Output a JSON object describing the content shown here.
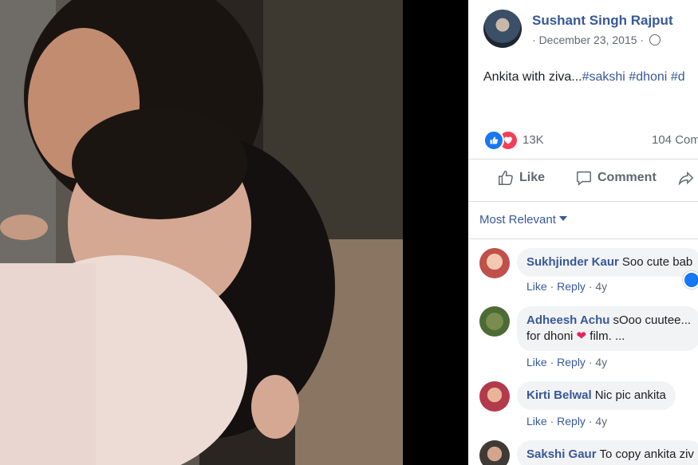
{
  "post": {
    "author": "Sushant Singh Rajput",
    "date": "December 23, 2015",
    "date_sep": "·",
    "caption_text": "Ankita with ziva...",
    "hashtags": [
      "#sakshi",
      "#dhoni",
      "#d"
    ]
  },
  "reactions": {
    "count": "13K",
    "comments": "104 Com"
  },
  "actions": {
    "like": "Like",
    "comment": "Comment"
  },
  "sort": {
    "label": "Most Relevant"
  },
  "comments": [
    {
      "name": "Sukhjinder Kaur",
      "text": "Soo cute bab",
      "like": "Like",
      "reply": "Reply",
      "time": "4y"
    },
    {
      "name": "Adheesh Achu",
      "text": "sOoo cuutee...",
      "text2": "for dhoni",
      "text2b": "film. ...",
      "like": "Like",
      "reply": "Reply",
      "time": "4y"
    },
    {
      "name": "Kirti Belwal",
      "text": "Nic pic ankita",
      "like": "Like",
      "reply": "Reply",
      "time": "4y"
    },
    {
      "name": "Sakshi Gaur",
      "text": "To copy ankita ziv"
    }
  ],
  "colors": {
    "link_blue": "#385898",
    "like_blue": "#1877f2",
    "love_red": "#f33e58"
  }
}
